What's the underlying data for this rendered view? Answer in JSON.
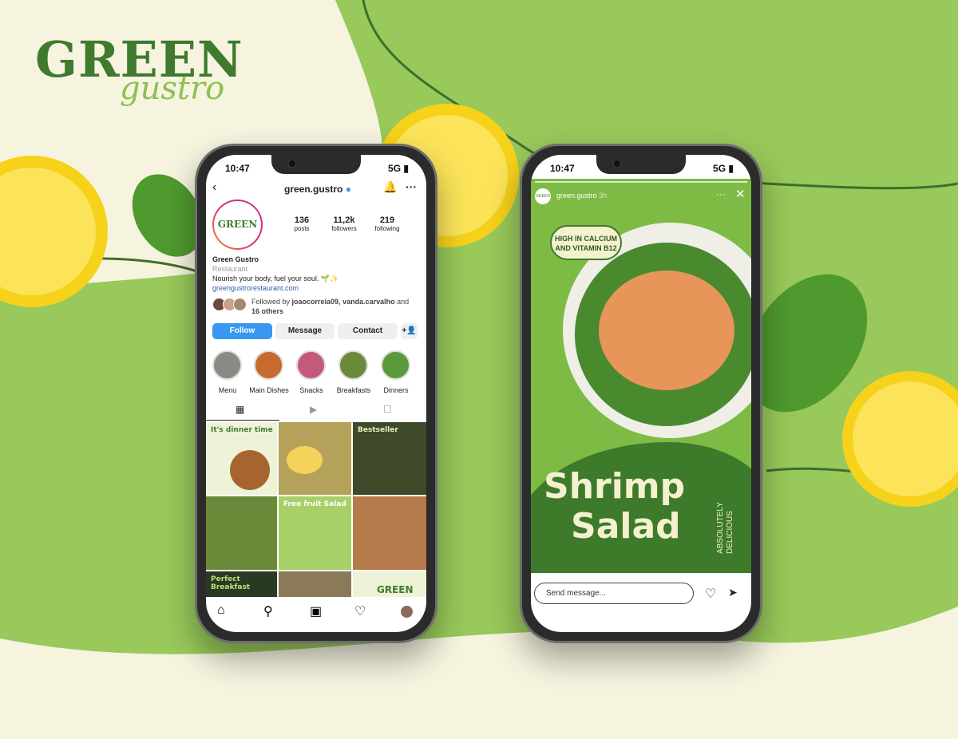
{
  "brand": {
    "logo_top": "GREEN",
    "logo_bottom": "gustro",
    "colors": {
      "green": "#98c95a",
      "dark_green": "#3f7a2e",
      "cream": "#f6f4df"
    }
  },
  "profile_phone": {
    "status": {
      "time": "10:47",
      "network": "5G"
    },
    "header": {
      "username": "green.gustro",
      "verified_icon": "verified-badge-icon"
    },
    "avatar_text": "GREEN",
    "stats": [
      {
        "value": "136",
        "label": "posts"
      },
      {
        "value": "11,2k",
        "label": "followers"
      },
      {
        "value": "219",
        "label": "following"
      }
    ],
    "name": "Green Gustro",
    "category": "Restaurant",
    "bio": "Nourish your body, fuel your soul. 🌱✨",
    "link": "greengustrorestaurant.com",
    "followed_by": {
      "prefix": "Followed by ",
      "users": "joaocorreia09, vanda.carvalho",
      "and": " and ",
      "others": "16 others"
    },
    "buttons": {
      "follow": "Follow",
      "message": "Message",
      "contact": "Contact",
      "add": "+👤"
    },
    "highlights": [
      "Menu",
      "Main Dishes",
      "Snacks",
      "Breakfasts",
      "Dinners"
    ],
    "posts": [
      {
        "title": "It's dinner time"
      },
      {
        "title": ""
      },
      {
        "title": "Bestseller"
      },
      {
        "title": ""
      },
      {
        "title": "Free fruit Salad"
      },
      {
        "title": ""
      },
      {
        "title": "Perfect Breakfast"
      },
      {
        "title": ""
      },
      {
        "title": "GREEN"
      }
    ]
  },
  "story_phone": {
    "status": {
      "time": "10:47",
      "network": "5G"
    },
    "username": "green.gustro",
    "time_ago": "3h",
    "bubble": "HIGH IN CALCIUM AND VITAMIN B12",
    "headline1": "Shrimp",
    "headline2": "Salad",
    "side1": "ABSOLUTELY",
    "side2": "DELICIOUS",
    "message_placeholder": "Send message..."
  }
}
